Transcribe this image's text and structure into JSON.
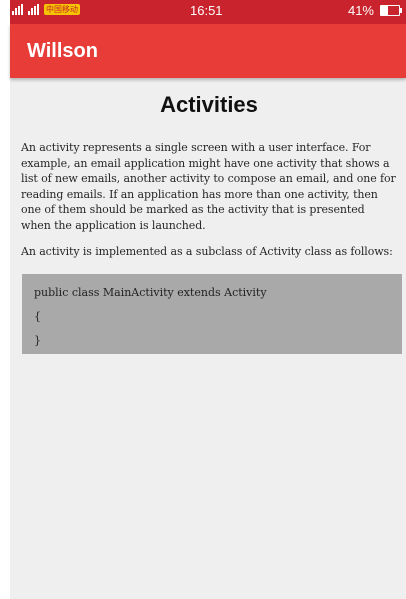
{
  "status_bar": {
    "carrier_badge": "中国移动",
    "time": "16:51",
    "battery_percent": "41%",
    "battery_level": 0.41
  },
  "app_bar": {
    "title": "Willson"
  },
  "content": {
    "title": "Activities",
    "paragraphs": [
      "An activity represents a single screen with a user interface. For example, an email application might have one activity that shows a list of new emails, another activity to compose an email, and one for reading emails. If an application has more than one activity, then one of them should be marked as the activity that is presented when the application is launched.",
      "An activity is implemented as a subclass of Activity class as follows:"
    ],
    "code_lines": [
      "public class MainActivity extends Activity",
      "{",
      "}"
    ]
  },
  "colors": {
    "status_bar": "#c9232d",
    "app_bar": "#e73c37",
    "background": "#efefef",
    "code_box": "#a9a9a9"
  }
}
